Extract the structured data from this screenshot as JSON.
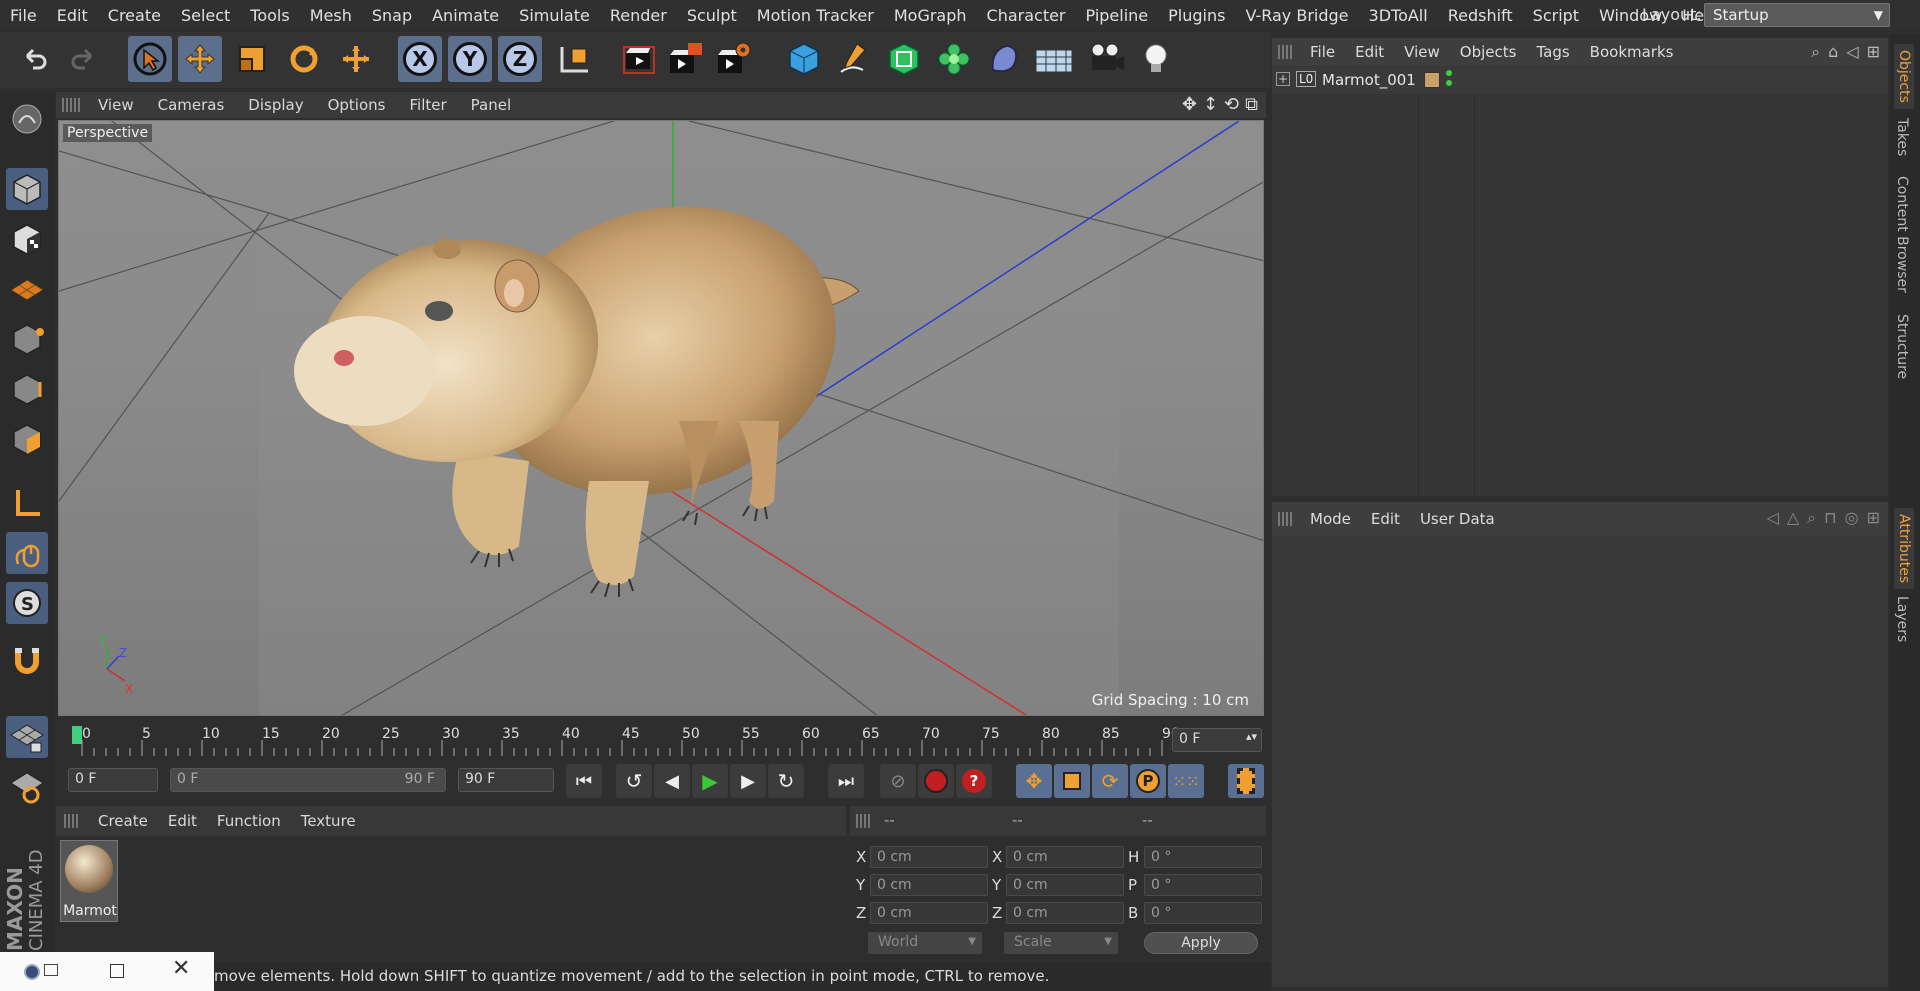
{
  "menubar": {
    "items": [
      "File",
      "Edit",
      "Create",
      "Select",
      "Tools",
      "Mesh",
      "Snap",
      "Animate",
      "Simulate",
      "Render",
      "Sculpt",
      "Motion Tracker",
      "MoGraph",
      "Character",
      "Pipeline",
      "Plugins",
      "V-Ray Bridge",
      "3DToAll",
      "Redshift",
      "Script",
      "Window",
      "Help"
    ],
    "layout_label": "Layout:",
    "layout_value": "Startup"
  },
  "toolbar": {
    "axis_x": "X",
    "axis_y": "Y",
    "axis_z": "Z",
    "icons": [
      "undo-icon",
      "redo-icon",
      "select-arrow-icon",
      "move-icon",
      "scale-icon",
      "rotate-icon",
      "live-select-icon",
      "coordinate-system-icon",
      "render-view-icon",
      "render-picture-viewer-icon",
      "render-settings-icon",
      "cube-icon",
      "pen-icon",
      "subdivision-icon",
      "cloner-icon",
      "deformer-icon",
      "floor-icon",
      "camera-icon",
      "light-icon"
    ]
  },
  "viewport": {
    "menu": [
      "View",
      "Cameras",
      "Display",
      "Options",
      "Filter",
      "Panel"
    ],
    "label": "Perspective",
    "grid_spacing": "Grid Spacing : 10 cm",
    "axis_y": "Y",
    "axis_z": "Z",
    "axis_x": "X"
  },
  "timeline": {
    "ticks": [
      "0",
      "5",
      "10",
      "15",
      "20",
      "25",
      "30",
      "35",
      "40",
      "45",
      "50",
      "55",
      "60",
      "65",
      "70",
      "75",
      "80",
      "85",
      "90"
    ],
    "current_frame": "0 F"
  },
  "controls": {
    "start_frame": "0 F",
    "range_start": "0 F",
    "range_end": "90 F",
    "end_frame": "90 F"
  },
  "material_manager": {
    "menu": [
      "Create",
      "Edit",
      "Function",
      "Texture"
    ],
    "material_name": "Marmot"
  },
  "coordinates": {
    "headers": [
      "--",
      "--",
      "--"
    ],
    "rows": [
      {
        "l1": "X",
        "v1": "0 cm",
        "l2": "X",
        "v2": "0 cm",
        "l3": "H",
        "v3": "0 °"
      },
      {
        "l1": "Y",
        "v1": "0 cm",
        "l2": "Y",
        "v2": "0 cm",
        "l3": "P",
        "v3": "0 °"
      },
      {
        "l1": "Z",
        "v1": "0 cm",
        "l2": "Z",
        "v2": "0 cm",
        "l3": "B",
        "v3": "0 °"
      }
    ],
    "mode_select": "World",
    "scale_select": "Scale",
    "apply_label": "Apply"
  },
  "object_manager": {
    "menu": [
      "File",
      "Edit",
      "View",
      "Objects",
      "Tags",
      "Bookmarks"
    ],
    "object_name": "Marmot_001",
    "object_badge": "L0"
  },
  "attribute_manager": {
    "menu": [
      "Mode",
      "Edit",
      "User Data"
    ]
  },
  "right_tabs": [
    "Objects",
    "Takes",
    "Content Browser",
    "Structure",
    "Attributes",
    "Layers"
  ],
  "statusbar": {
    "text": "move elements. Hold down SHIFT to quantize movement / add to the selection in point mode, CTRL to remove."
  },
  "brand": {
    "line1": "MAXON",
    "line2": "CINEMA 4D"
  },
  "colors": {
    "accent": "#5c6f8c",
    "axis_red": "#d03030",
    "axis_green": "#30b030",
    "axis_blue": "#3030d0",
    "play_green": "#3cc83c"
  }
}
